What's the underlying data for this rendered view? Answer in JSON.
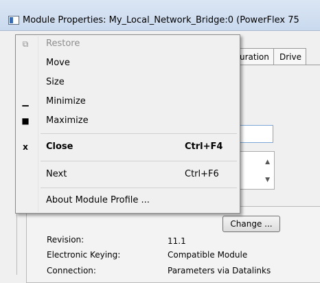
{
  "window": {
    "title": "Module Properties: My_Local_Network_Bridge:0 (PowerFlex 75"
  },
  "tabs": [
    "uration",
    "Drive"
  ],
  "background": {
    "change_button": "Change ...",
    "fields": [
      {
        "label": "Revision:",
        "value": "11.1"
      },
      {
        "label": "Electronic Keying:",
        "value": "Compatible Module"
      },
      {
        "label": "Connection:",
        "value": "Parameters via Datalinks"
      }
    ]
  },
  "system_menu": {
    "items": [
      {
        "label": "Restore",
        "accel": "",
        "glyph": "restore-icon"
      },
      {
        "label": "Move",
        "accel": "",
        "glyph": ""
      },
      {
        "label": "Size",
        "accel": "",
        "glyph": ""
      },
      {
        "label": "Minimize",
        "accel": "",
        "glyph": "minimize-icon"
      },
      {
        "label": "Maximize",
        "accel": "",
        "glyph": "maximize-icon"
      },
      {
        "label": "Close",
        "accel": "Ctrl+F4",
        "glyph": "close-icon"
      },
      {
        "label": "Next",
        "accel": "Ctrl+F6",
        "glyph": ""
      },
      {
        "label": "About Module Profile ...",
        "accel": "",
        "glyph": ""
      }
    ]
  }
}
